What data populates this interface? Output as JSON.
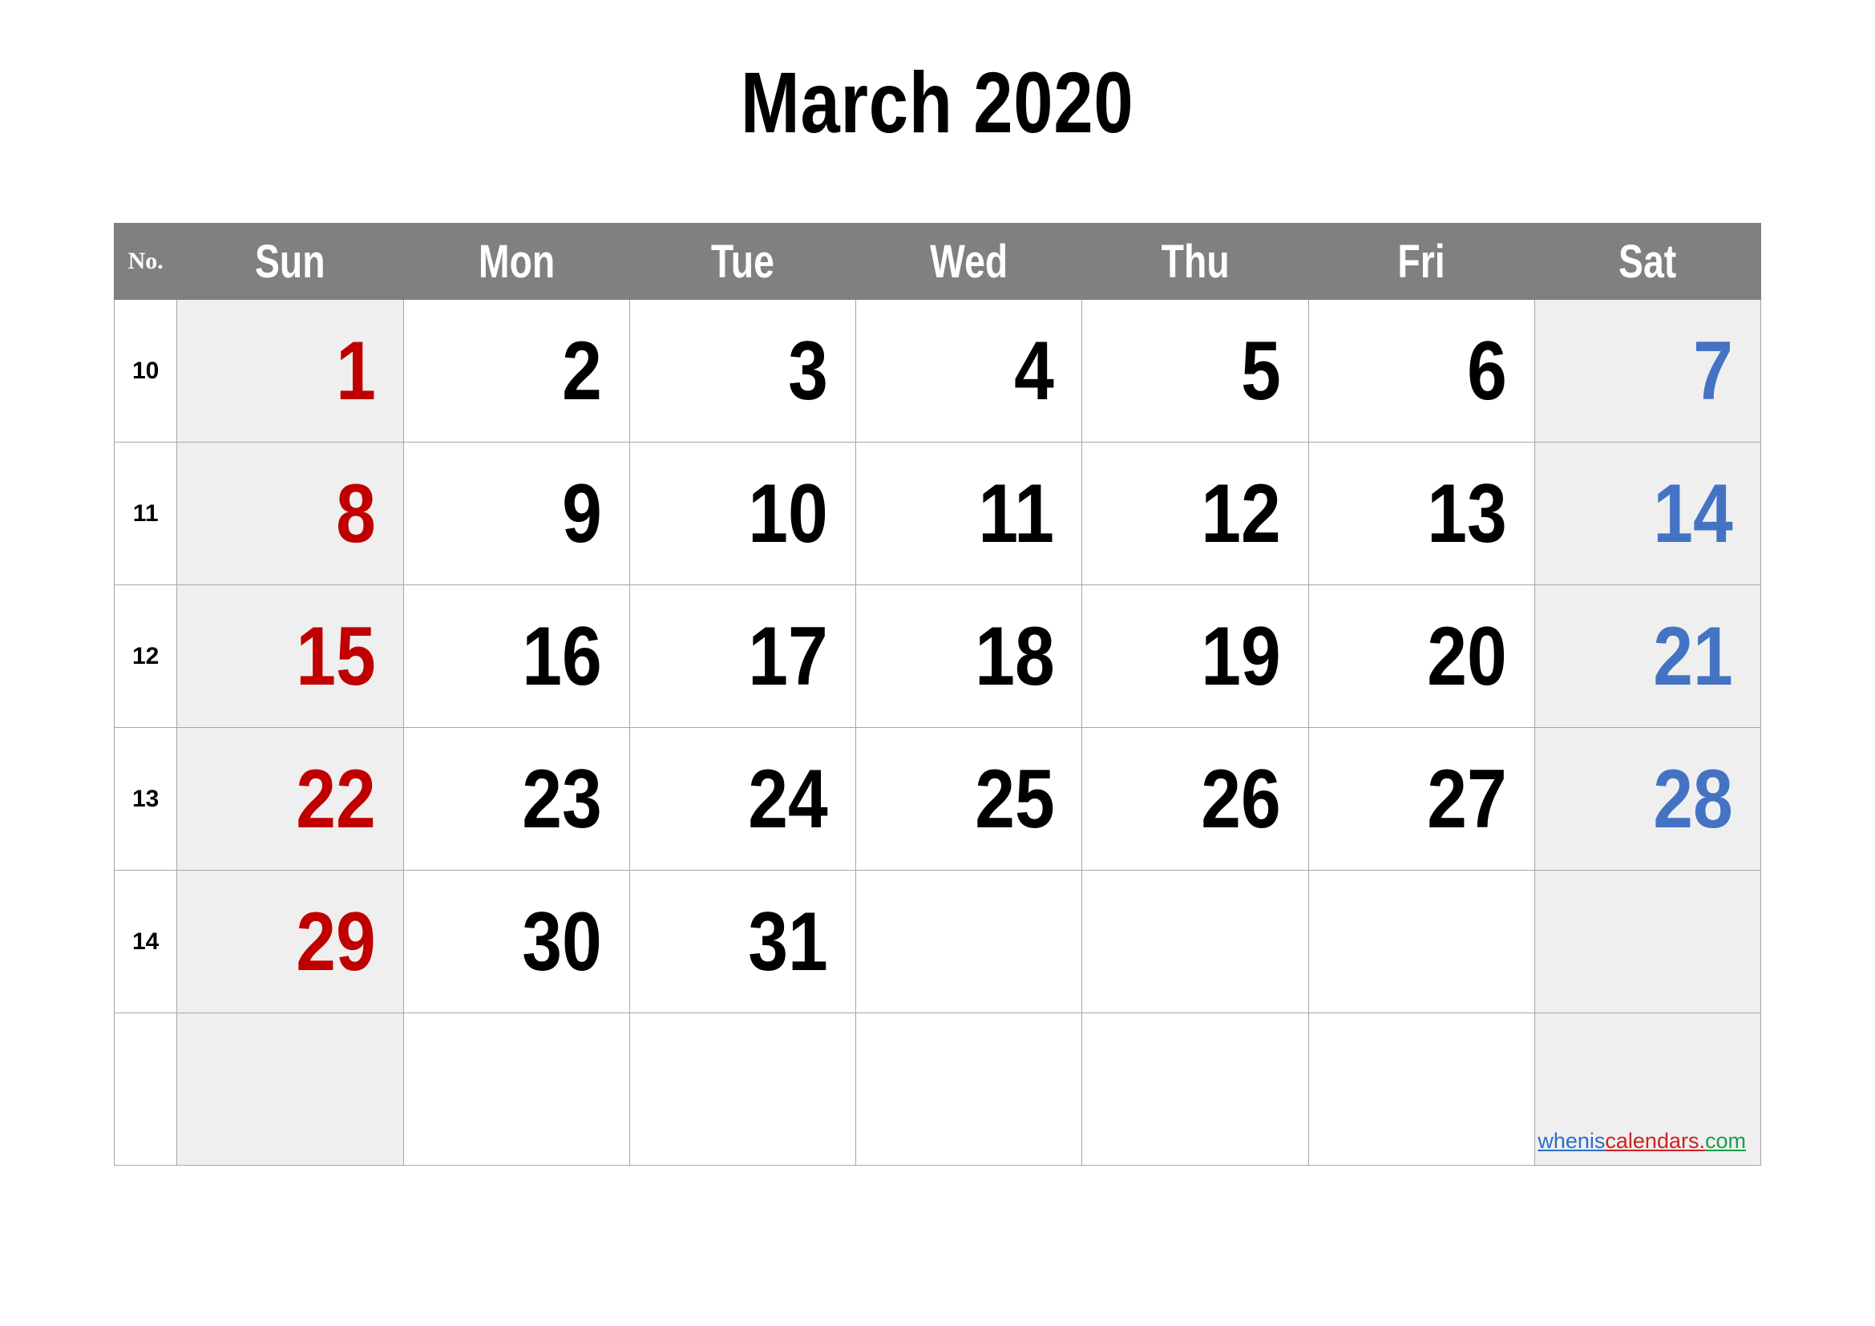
{
  "title": "March 2020",
  "colors": {
    "header_bg": "#808080",
    "header_text": "#ffffff",
    "weekend_cell_bg": "#efefef",
    "sunday_number": "#c00000",
    "saturday_number": "#4573c4",
    "weekday_number": "#000000",
    "grid_border": "#a6a6a6",
    "page_bg": "#ffffff"
  },
  "header": {
    "week_col_label": "No.",
    "days": [
      "Sun",
      "Mon",
      "Tue",
      "Wed",
      "Thu",
      "Fri",
      "Sat"
    ]
  },
  "weeks": [
    {
      "no": "10",
      "days": [
        "1",
        "2",
        "3",
        "4",
        "5",
        "6",
        "7"
      ]
    },
    {
      "no": "11",
      "days": [
        "8",
        "9",
        "10",
        "11",
        "12",
        "13",
        "14"
      ]
    },
    {
      "no": "12",
      "days": [
        "15",
        "16",
        "17",
        "18",
        "19",
        "20",
        "21"
      ]
    },
    {
      "no": "13",
      "days": [
        "22",
        "23",
        "24",
        "25",
        "26",
        "27",
        "28"
      ]
    },
    {
      "no": "14",
      "days": [
        "29",
        "30",
        "31",
        "",
        "",
        "",
        ""
      ]
    },
    {
      "no": "",
      "days": [
        "",
        "",
        "",
        "",
        "",
        "",
        ""
      ]
    }
  ],
  "watermark": {
    "part1": "whenis",
    "part2": "calendars.",
    "part3": "com"
  }
}
